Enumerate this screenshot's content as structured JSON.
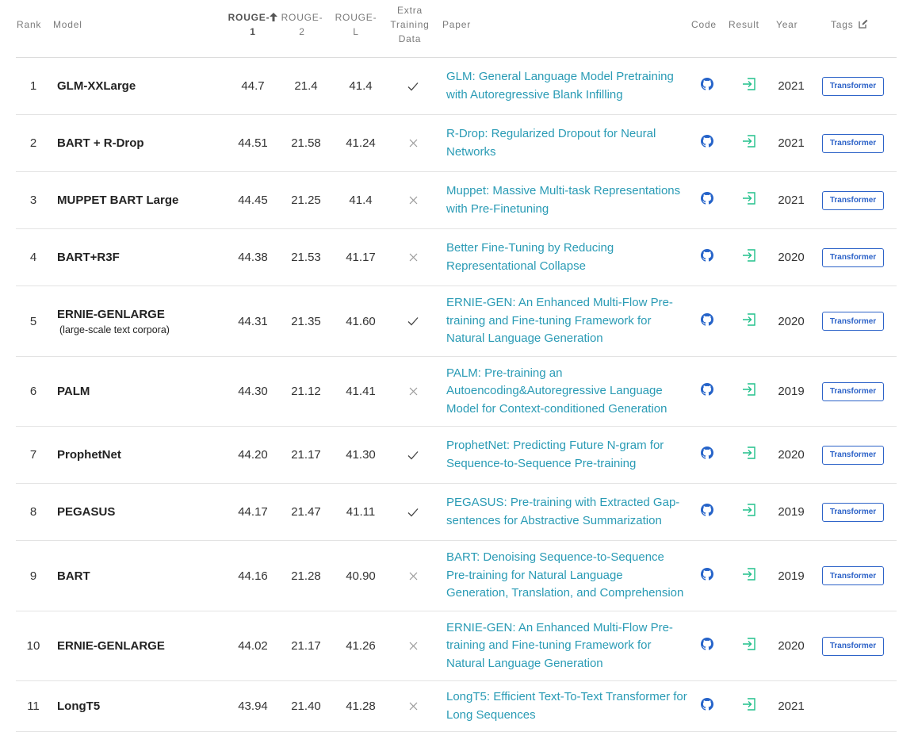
{
  "colors": {
    "link": "#2a9bb5",
    "tag_border": "#2d63c8",
    "result_icon": "#21c08b",
    "github_icon": "#2563c9"
  },
  "header": {
    "rank": "Rank",
    "model": "Model",
    "rouge1_line1": "ROUGE-",
    "rouge1_line2": "1",
    "rouge2_line1": "ROUGE-",
    "rouge2_line2": "2",
    "rougel_line1": "ROUGE-",
    "rougel_line2": "L",
    "extra_line1": "Extra",
    "extra_line2": "Training",
    "extra_line3": "Data",
    "paper": "Paper",
    "code": "Code",
    "result": "Result",
    "year": "Year",
    "tags": "Tags",
    "sort_icon": "arrow-up-icon",
    "edit_icon": "edit-icon"
  },
  "rows": [
    {
      "rank": "1",
      "model": "GLM-XXLarge",
      "sub": "",
      "rouge1": "44.7",
      "rouge2": "21.4",
      "rougel": "41.4",
      "extra": "check",
      "paper": "GLM: General Language Model Pretraining with Autoregressive Blank Infilling",
      "year": "2021",
      "tag": "Transformer"
    },
    {
      "rank": "2",
      "model": "BART + R-Drop",
      "sub": "",
      "rouge1": "44.51",
      "rouge2": "21.58",
      "rougel": "41.24",
      "extra": "cross",
      "paper": "R-Drop: Regularized Dropout for Neural Networks",
      "year": "2021",
      "tag": "Transformer"
    },
    {
      "rank": "3",
      "model": "MUPPET BART Large",
      "sub": "",
      "rouge1": "44.45",
      "rouge2": "21.25",
      "rougel": "41.4",
      "extra": "cross",
      "paper": "Muppet: Massive Multi-task Representations with Pre-Finetuning",
      "year": "2021",
      "tag": "Transformer"
    },
    {
      "rank": "4",
      "model": "BART+R3F",
      "sub": "",
      "rouge1": "44.38",
      "rouge2": "21.53",
      "rougel": "41.17",
      "extra": "cross",
      "paper": "Better Fine-Tuning by Reducing Representational Collapse",
      "year": "2020",
      "tag": "Transformer"
    },
    {
      "rank": "5",
      "model": "ERNIE-GENLARGE",
      "sub": "(large-scale text corpora)",
      "rouge1": "44.31",
      "rouge2": "21.35",
      "rougel": "41.60",
      "extra": "check",
      "paper": "ERNIE-GEN: An Enhanced Multi-Flow Pre-training and Fine-tuning Framework for Natural Language Generation",
      "year": "2020",
      "tag": "Transformer"
    },
    {
      "rank": "6",
      "model": "PALM",
      "sub": "",
      "rouge1": "44.30",
      "rouge2": "21.12",
      "rougel": "41.41",
      "extra": "cross",
      "paper": "PALM: Pre-training an Autoencoding&Autoregressive Language Model for Context-conditioned Generation",
      "year": "2019",
      "tag": "Transformer"
    },
    {
      "rank": "7",
      "model": "ProphetNet",
      "sub": "",
      "rouge1": "44.20",
      "rouge2": "21.17",
      "rougel": "41.30",
      "extra": "check",
      "paper": "ProphetNet: Predicting Future N-gram for Sequence-to-Sequence Pre-training",
      "year": "2020",
      "tag": "Transformer"
    },
    {
      "rank": "8",
      "model": "PEGASUS",
      "sub": "",
      "rouge1": "44.17",
      "rouge2": "21.47",
      "rougel": "41.11",
      "extra": "check",
      "paper": "PEGASUS: Pre-training with Extracted Gap-sentences for Abstractive Summarization",
      "year": "2019",
      "tag": "Transformer"
    },
    {
      "rank": "9",
      "model": "BART",
      "sub": "",
      "rouge1": "44.16",
      "rouge2": "21.28",
      "rougel": "40.90",
      "extra": "cross",
      "paper": "BART: Denoising Sequence-to-Sequence Pre-training for Natural Language Generation, Translation, and Comprehension",
      "year": "2019",
      "tag": "Transformer"
    },
    {
      "rank": "10",
      "model": "ERNIE-GENLARGE",
      "sub": "",
      "rouge1": "44.02",
      "rouge2": "21.17",
      "rougel": "41.26",
      "extra": "cross",
      "paper": "ERNIE-GEN: An Enhanced Multi-Flow Pre-training and Fine-tuning Framework for Natural Language Generation",
      "year": "2020",
      "tag": "Transformer"
    },
    {
      "rank": "11",
      "model": "LongT5",
      "sub": "",
      "rouge1": "43.94",
      "rouge2": "21.40",
      "rougel": "41.28",
      "extra": "cross",
      "paper": "LongT5: Efficient Text-To-Text Transformer for Long Sequences",
      "year": "2021",
      "tag": ""
    }
  ]
}
